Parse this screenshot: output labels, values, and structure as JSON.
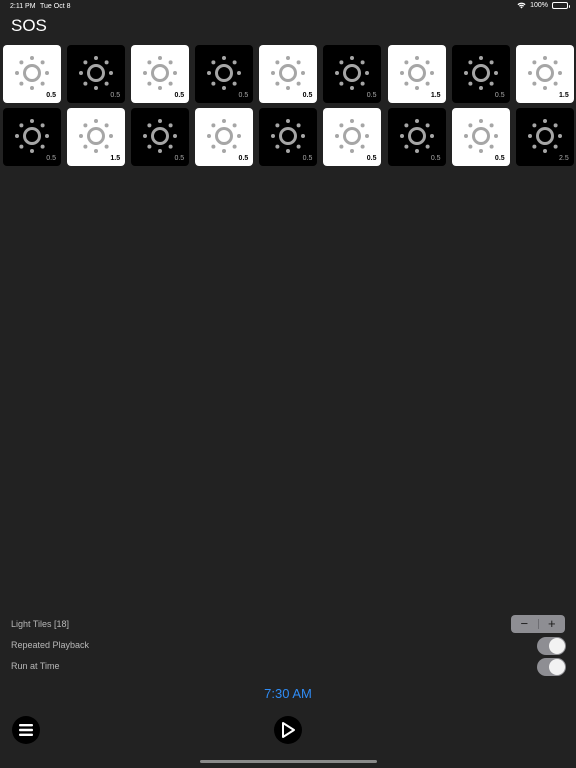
{
  "status_bar": {
    "time": "2:11 PM",
    "date": "Tue Oct 8",
    "battery": "100%",
    "wifi_icon": "wifi-icon",
    "battery_icon": "battery-icon"
  },
  "title": "SOS",
  "tiles": [
    {
      "tone": "light",
      "duration": "0.5"
    },
    {
      "tone": "dark",
      "duration": "0.5"
    },
    {
      "tone": "light",
      "duration": "0.5"
    },
    {
      "tone": "dark",
      "duration": "0.5"
    },
    {
      "tone": "light",
      "duration": "0.5"
    },
    {
      "tone": "dark",
      "duration": "0.5"
    },
    {
      "tone": "light",
      "duration": "1.5"
    },
    {
      "tone": "dark",
      "duration": "0.5"
    },
    {
      "tone": "light",
      "duration": "1.5"
    },
    {
      "tone": "dark",
      "duration": "0.5"
    },
    {
      "tone": "light",
      "duration": "1.5"
    },
    {
      "tone": "dark",
      "duration": "0.5"
    },
    {
      "tone": "light",
      "duration": "0.5"
    },
    {
      "tone": "dark",
      "duration": "0.5"
    },
    {
      "tone": "light",
      "duration": "0.5"
    },
    {
      "tone": "dark",
      "duration": "0.5"
    },
    {
      "tone": "light",
      "duration": "0.5"
    },
    {
      "tone": "dark",
      "duration": "2.5"
    }
  ],
  "settings": {
    "light_tiles_label": "Light Tiles [18]",
    "stepper_minus": "−",
    "stepper_plus": "+",
    "repeated_playback_label": "Repeated Playback",
    "repeated_playback_on": true,
    "run_at_time_label": "Run at Time",
    "run_at_time_on": true
  },
  "run_time": "7:30 AM",
  "toolbar": {
    "menu_icon": "menu-icon",
    "play_icon": "play-icon"
  },
  "colors": {
    "background": "#222222",
    "accent": "#2f8cf5",
    "tile_light": "#ffffff",
    "tile_dark": "#000000"
  }
}
